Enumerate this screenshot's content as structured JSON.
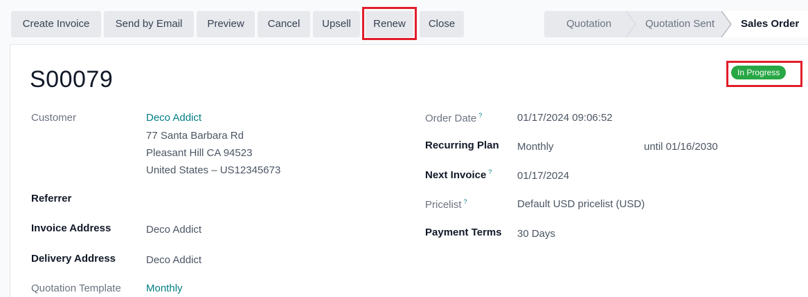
{
  "toolbar": {
    "create_invoice": "Create Invoice",
    "send_by_email": "Send by Email",
    "preview": "Preview",
    "cancel": "Cancel",
    "upsell": "Upsell",
    "renew": "Renew",
    "close": "Close"
  },
  "statusbar": {
    "steps": [
      "Quotation",
      "Quotation Sent",
      "Sales Order"
    ],
    "active": "Sales Order"
  },
  "record": {
    "name": "S00079",
    "status_badge": "In Progress"
  },
  "left": {
    "customer_label": "Customer",
    "customer_name": "Deco Addict",
    "address_line1": "77 Santa Barbara Rd",
    "address_line2": "Pleasant Hill CA 94523",
    "address_line3": "United States – US12345673",
    "referrer_label": "Referrer",
    "invoice_address_label": "Invoice Address",
    "invoice_address_value": "Deco Addict",
    "delivery_address_label": "Delivery Address",
    "delivery_address_value": "Deco Addict",
    "quotation_template_label": "Quotation Template",
    "quotation_template_value": "Monthly"
  },
  "right": {
    "order_date_label": "Order Date",
    "order_date_value": "01/17/2024 09:06:52",
    "recurring_plan_label": "Recurring Plan",
    "recurring_plan_value": "Monthly",
    "recurring_until": "until 01/16/2030",
    "next_invoice_label": "Next Invoice",
    "next_invoice_value": "01/17/2024",
    "pricelist_label": "Pricelist",
    "pricelist_value": "Default USD pricelist (USD)",
    "payment_terms_label": "Payment Terms",
    "payment_terms_value": "30 Days",
    "tooltip_mark": "?"
  },
  "colors": {
    "highlight": "#e11d2a",
    "badge": "#28a745",
    "link": "#017e84"
  }
}
